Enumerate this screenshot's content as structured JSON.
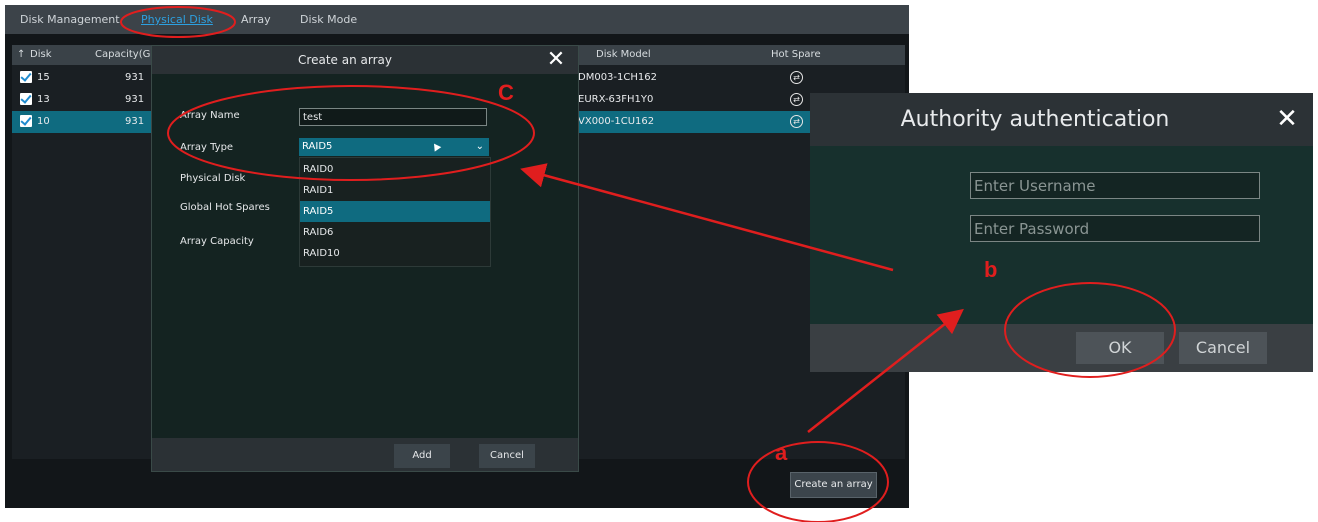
{
  "nvr": {
    "tabs": [
      "Disk Management",
      "Physical Disk",
      "Array",
      "Disk Mode"
    ],
    "table": {
      "columns": [
        "Disk",
        "Capacity(GI",
        "Disk Model",
        "Hot Spare"
      ],
      "rows": [
        {
          "disk": "15",
          "capacity": "931",
          "model": "DM003-1CH162",
          "selected": false
        },
        {
          "disk": "13",
          "capacity": "931",
          "model": "EURX-63FH1Y0",
          "selected": false
        },
        {
          "disk": "10",
          "capacity": "931",
          "model": "VX000-1CU162",
          "selected": true
        }
      ],
      "sort_icon": "up-arrow-icon",
      "hot_spare_icon": "circle-arrows-icon"
    },
    "create_button": "Create an array"
  },
  "create_dialog": {
    "title": "Create an array",
    "close_icon": "close-icon",
    "labels": {
      "array_name": "Array Name",
      "array_type": "Array Type",
      "physical_disk": "Physical Disk",
      "global_hot_spares": "Global Hot Spares",
      "array_capacity": "Array Capacity"
    },
    "array_name_value": "test",
    "array_type_value": "RAID5",
    "options": [
      "RAID0",
      "RAID1",
      "RAID5",
      "RAID6",
      "RAID10"
    ],
    "selected_option": "RAID5",
    "buttons": {
      "add": "Add",
      "cancel": "Cancel"
    }
  },
  "auth_dialog": {
    "title": "Authority authentication",
    "close_icon": "close-icon",
    "username_placeholder": "Enter Username",
    "password_placeholder": "Enter Password",
    "buttons": {
      "ok": "OK",
      "cancel": "Cancel"
    }
  },
  "annotations": {
    "a": "a",
    "b": "b",
    "c": "C",
    "color": "#e01e1e"
  },
  "colors": {
    "accent": "#0f6b80",
    "link": "#2da0e0",
    "annotation": "#e01e1e"
  }
}
